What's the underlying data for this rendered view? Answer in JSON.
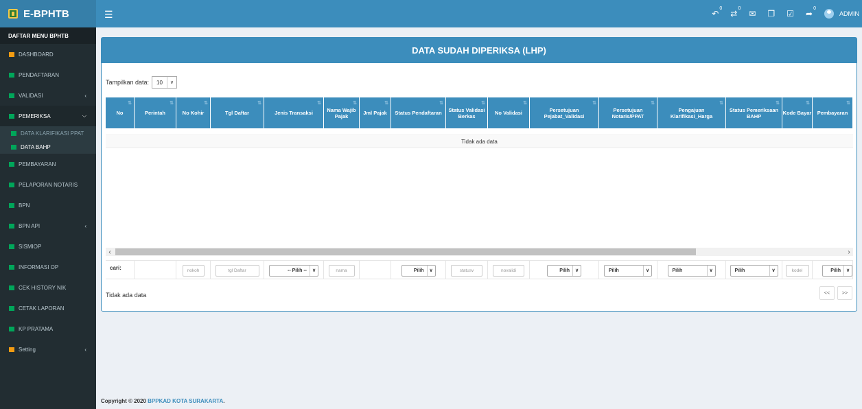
{
  "app": {
    "title": "E-BPHTB",
    "user": "ADMIN"
  },
  "header_icons": [
    {
      "icon": "reply-icon",
      "count": "0"
    },
    {
      "icon": "transfer-icon",
      "count": "0"
    },
    {
      "icon": "mail-icon",
      "count": ""
    },
    {
      "icon": "copy-icon",
      "count": ""
    },
    {
      "icon": "check-square-icon",
      "count": ""
    },
    {
      "icon": "share-icon",
      "count": "0"
    }
  ],
  "sidebar": {
    "header": "DAFTAR MENU BPHTB",
    "items": [
      {
        "label": "DASHBOARD",
        "icon": "grid-icon",
        "color": "#f39c12"
      },
      {
        "label": "PENDAFTARAN",
        "icon": "list-icon",
        "color": "#00a65a"
      },
      {
        "label": "VALIDASI",
        "icon": "check-icon",
        "color": "#00a65a",
        "chevron": "<"
      },
      {
        "label": "PEMERIKSA",
        "icon": "check-icon",
        "color": "#00a65a",
        "chevron": "v",
        "active": true
      },
      {
        "label": "DATA KLARIFIKASI PPAT",
        "icon": "file-icon",
        "color": "#00a65a",
        "sub": true
      },
      {
        "label": "DATA BAHP",
        "icon": "file-icon",
        "color": "#00a65a",
        "sub": true
      },
      {
        "label": "PEMBAYARAN",
        "icon": "money-icon",
        "color": "#00a65a"
      },
      {
        "label": "PELAPORAN NOTARIS",
        "icon": "book-icon",
        "color": "#00a65a"
      },
      {
        "label": "BPN",
        "icon": "bank-icon",
        "color": "#00a65a"
      },
      {
        "label": "BPN API",
        "icon": "exchange-icon",
        "color": "#00a65a",
        "chevron": "<"
      },
      {
        "label": "SISMIOP",
        "icon": "table-icon",
        "color": "#00a65a"
      },
      {
        "label": "INFORMASI OP",
        "icon": "info-icon",
        "color": "#00a65a"
      },
      {
        "label": "CEK HISTORY NIK",
        "icon": "search-icon",
        "color": "#00a65a"
      },
      {
        "label": "CETAK LAPORAN",
        "icon": "tag-icon",
        "color": "#00a65a"
      },
      {
        "label": "KP PRATAMA",
        "icon": "list-icon",
        "color": "#00a65a"
      },
      {
        "label": "Setting",
        "icon": "gears-icon",
        "color": "#f39c12",
        "chevron": "<"
      }
    ]
  },
  "main": {
    "title": "DATA SUDAH DIPERIKSA (LHP)",
    "length_label": "Tampilkan data:",
    "length_value": "10",
    "columns": [
      "No",
      "Perintah",
      "No Kohir",
      "Tgl Daftar",
      "Jenis Transaksi",
      "Nama Wajib Pajak",
      "Jml Pajak",
      "Status Pendaftaran",
      "Status Validasi Berkas",
      "No Validasi",
      "Persetujuan Pejabat_Validasi",
      "Persetujuan Notaris/PPAT",
      "Pengajuan Klarifikasi_Harga",
      "Status Pemeriksaan BAHP",
      "Kode Bayar",
      "Pembayaran"
    ],
    "empty_text": "Tidak ada data",
    "filter": {
      "label": "cari:",
      "nokoh_placeholder": "nokoh",
      "tgl_placeholder": "tgl Daftar",
      "jenis_value": "-- Pilih --",
      "nama_placeholder": "nama",
      "status_value": "Pilih",
      "statusv_placeholder": "statusv",
      "novalid_placeholder": "novalidi",
      "pejabat_value": "Pilih",
      "notaris_value": "Pilih",
      "klarifikasi_value": "Pilih",
      "bahp_value": "Pilih",
      "kode_placeholder": "kodel",
      "pembayaran_value": "Pilih"
    },
    "info_text": "Tidak ada data",
    "pager": {
      "prev": "<<",
      "next": ">>"
    }
  },
  "footer": {
    "text": "Copyright © 2020",
    "link": "BPPKAD KOTA SURAKARTA",
    "suffix": "."
  }
}
